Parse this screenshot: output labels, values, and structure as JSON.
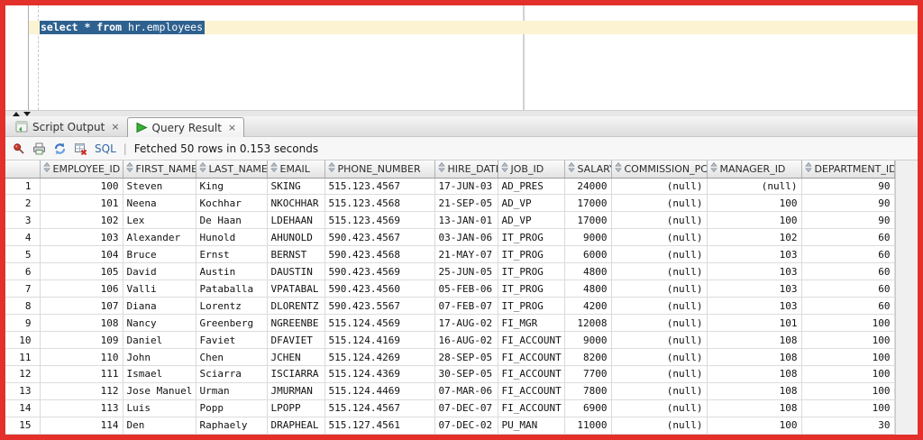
{
  "editor": {
    "sql_selected_keywords": "select * from",
    "sql_selected_rest": " hr.employees"
  },
  "tabs": [
    {
      "label": "Script Output",
      "icon": "script-output",
      "close": "×"
    },
    {
      "label": "Query Result",
      "icon": "query-result",
      "close": "×"
    }
  ],
  "toolbar": {
    "icons": [
      "pin",
      "print",
      "refresh",
      "clear-grid"
    ],
    "sql_link": "SQL",
    "separator": "|",
    "status": "Fetched 50 rows in 0.153 seconds"
  },
  "table": {
    "headers": [
      "EMPLOYEE_ID",
      "FIRST_NAME",
      "LAST_NAME",
      "EMAIL",
      "PHONE_NUMBER",
      "HIRE_DATE",
      "JOB_ID",
      "SALARY",
      "COMMISSION_PCT",
      "MANAGER_ID",
      "DEPARTMENT_ID"
    ],
    "rows": [
      [
        "1",
        "100",
        "Steven",
        "King",
        "SKING",
        "515.123.4567",
        "17-JUN-03",
        "AD_PRES",
        "24000",
        "(null)",
        "(null)",
        "90"
      ],
      [
        "2",
        "101",
        "Neena",
        "Kochhar",
        "NKOCHHAR",
        "515.123.4568",
        "21-SEP-05",
        "AD_VP",
        "17000",
        "(null)",
        "100",
        "90"
      ],
      [
        "3",
        "102",
        "Lex",
        "De Haan",
        "LDEHAAN",
        "515.123.4569",
        "13-JAN-01",
        "AD_VP",
        "17000",
        "(null)",
        "100",
        "90"
      ],
      [
        "4",
        "103",
        "Alexander",
        "Hunold",
        "AHUNOLD",
        "590.423.4567",
        "03-JAN-06",
        "IT_PROG",
        "9000",
        "(null)",
        "102",
        "60"
      ],
      [
        "5",
        "104",
        "Bruce",
        "Ernst",
        "BERNST",
        "590.423.4568",
        "21-MAY-07",
        "IT_PROG",
        "6000",
        "(null)",
        "103",
        "60"
      ],
      [
        "6",
        "105",
        "David",
        "Austin",
        "DAUSTIN",
        "590.423.4569",
        "25-JUN-05",
        "IT_PROG",
        "4800",
        "(null)",
        "103",
        "60"
      ],
      [
        "7",
        "106",
        "Valli",
        "Pataballa",
        "VPATABAL",
        "590.423.4560",
        "05-FEB-06",
        "IT_PROG",
        "4800",
        "(null)",
        "103",
        "60"
      ],
      [
        "8",
        "107",
        "Diana",
        "Lorentz",
        "DLORENTZ",
        "590.423.5567",
        "07-FEB-07",
        "IT_PROG",
        "4200",
        "(null)",
        "103",
        "60"
      ],
      [
        "9",
        "108",
        "Nancy",
        "Greenberg",
        "NGREENBE",
        "515.124.4569",
        "17-AUG-02",
        "FI_MGR",
        "12008",
        "(null)",
        "101",
        "100"
      ],
      [
        "10",
        "109",
        "Daniel",
        "Faviet",
        "DFAVIET",
        "515.124.4169",
        "16-AUG-02",
        "FI_ACCOUNT",
        "9000",
        "(null)",
        "108",
        "100"
      ],
      [
        "11",
        "110",
        "John",
        "Chen",
        "JCHEN",
        "515.124.4269",
        "28-SEP-05",
        "FI_ACCOUNT",
        "8200",
        "(null)",
        "108",
        "100"
      ],
      [
        "12",
        "111",
        "Ismael",
        "Sciarra",
        "ISCIARRA",
        "515.124.4369",
        "30-SEP-05",
        "FI_ACCOUNT",
        "7700",
        "(null)",
        "108",
        "100"
      ],
      [
        "13",
        "112",
        "Jose Manuel",
        "Urman",
        "JMURMAN",
        "515.124.4469",
        "07-MAR-06",
        "FI_ACCOUNT",
        "7800",
        "(null)",
        "108",
        "100"
      ],
      [
        "14",
        "113",
        "Luis",
        "Popp",
        "LPOPP",
        "515.124.4567",
        "07-DEC-07",
        "FI_ACCOUNT",
        "6900",
        "(null)",
        "108",
        "100"
      ],
      [
        "15",
        "114",
        "Den",
        "Raphaely",
        "DRAPHEAL",
        "515.127.4561",
        "07-DEC-02",
        "PU_MAN",
        "11000",
        "(null)",
        "100",
        "30"
      ]
    ]
  },
  "colors": {
    "frame_border": "#e3302a",
    "selection": "#2e618f",
    "current_line": "#fcf3d2",
    "sql_link": "#3568a8"
  }
}
